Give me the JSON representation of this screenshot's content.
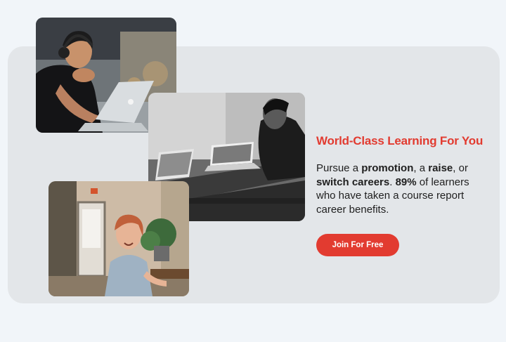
{
  "hero": {
    "heading": "World-Class Learning For You",
    "description": {
      "t1": "Pursue a ",
      "b1": "promotion",
      "t2": ", a ",
      "b2": "raise",
      "t3": ", or ",
      "b3": "switch careers",
      "t4": ". ",
      "b4": "89%",
      "t5": " of learners who have taken a course report career benefits."
    },
    "cta_label": "Join For Free"
  },
  "colors": {
    "accent": "#e23b30",
    "panel": "#e3e6e9",
    "page": "#f1f5f9",
    "text": "#1f1f1f"
  },
  "images": [
    "man-with-headphones-laptop-photo",
    "team-at-laptops-monochrome-photo",
    "smiling-woman-cafe-photo"
  ]
}
